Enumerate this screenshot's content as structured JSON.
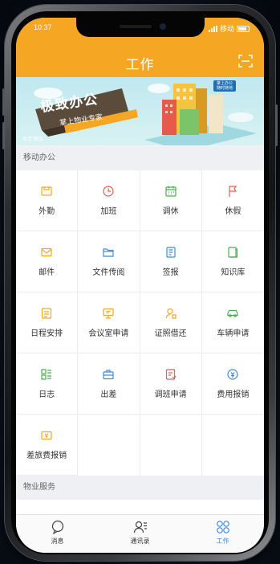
{
  "status": {
    "time": "10:37",
    "carrier": "移动"
  },
  "header": {
    "title": "工作",
    "scan_icon": "scan-icon"
  },
  "banner": {
    "title": "极致办公",
    "subtitle": "掌上物业专家",
    "brand": "东宝·物业",
    "bubble": "掌上办公 随时随地"
  },
  "sections": [
    {
      "label": "移动办公",
      "items": [
        {
          "label": "外勤",
          "icon": "field-work-icon",
          "color": "#f5a623"
        },
        {
          "label": "加班",
          "icon": "clock-icon",
          "color": "#e85d4f"
        },
        {
          "label": "调休",
          "icon": "calendar-icon",
          "color": "#4cae4f"
        },
        {
          "label": "休假",
          "icon": "flag-icon",
          "color": "#e85d4f"
        },
        {
          "label": "邮件",
          "icon": "mail-icon",
          "color": "#f5a623"
        },
        {
          "label": "文件传阅",
          "icon": "folder-icon",
          "color": "#3a8cdb"
        },
        {
          "label": "签报",
          "icon": "document-icon",
          "color": "#3a8cdb"
        },
        {
          "label": "知识库",
          "icon": "book-icon",
          "color": "#4cae4f"
        },
        {
          "label": "日程安排",
          "icon": "schedule-icon",
          "color": "#f5a623"
        },
        {
          "label": "会议室申请",
          "icon": "meeting-room-icon",
          "color": "#f5a623"
        },
        {
          "label": "证照借还",
          "icon": "certificate-icon",
          "color": "#f5a623"
        },
        {
          "label": "车辆申请",
          "icon": "car-icon",
          "color": "#4cae4f"
        },
        {
          "label": "日志",
          "icon": "log-icon",
          "color": "#4cae4f"
        },
        {
          "label": "出差",
          "icon": "suitcase-icon",
          "color": "#3a8cdb"
        },
        {
          "label": "调班申请",
          "icon": "shift-icon",
          "color": "#e85d4f"
        },
        {
          "label": "费用报销",
          "icon": "expense-icon",
          "color": "#3a8cdb"
        },
        {
          "label": "差旅费报销",
          "icon": "travel-expense-icon",
          "color": "#f5a623"
        }
      ]
    },
    {
      "label": "物业服务"
    }
  ],
  "tabbar": [
    {
      "label": "消息",
      "icon": "chat-bubble-icon",
      "active": false
    },
    {
      "label": "通讯录",
      "icon": "contacts-icon",
      "active": false
    },
    {
      "label": "工作",
      "icon": "work-grid-icon",
      "active": true
    }
  ],
  "colors": {
    "header": "#f5a623",
    "active_tab": "#3a8cdb"
  }
}
